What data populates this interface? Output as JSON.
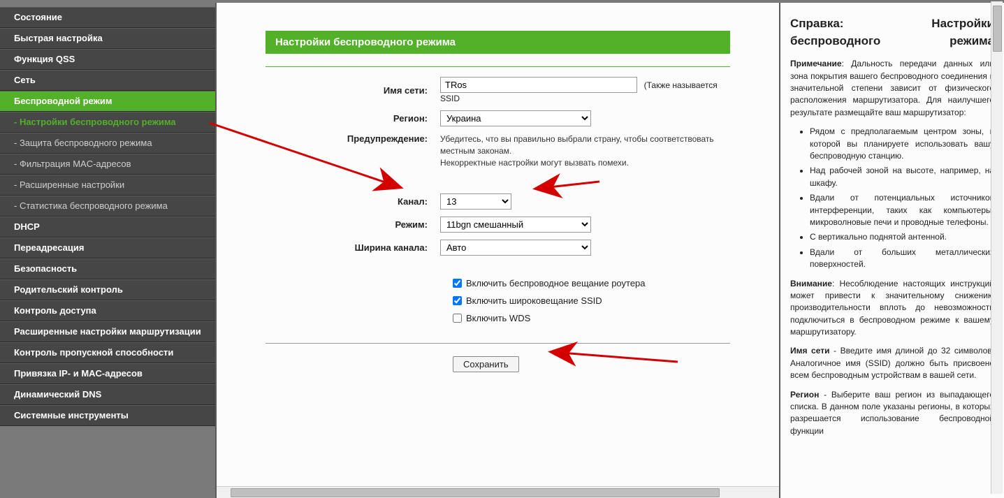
{
  "sidebar": {
    "items": [
      {
        "label": "Состояние",
        "type": "item"
      },
      {
        "label": "Быстрая настройка",
        "type": "item"
      },
      {
        "label": "Функция QSS",
        "type": "item"
      },
      {
        "label": "Сеть",
        "type": "item"
      },
      {
        "label": "Беспроводной режим",
        "type": "item",
        "active": true
      },
      {
        "label": "- Настройки беспроводного режима",
        "type": "sub",
        "current": true
      },
      {
        "label": "- Защита беспроводного режима",
        "type": "sub"
      },
      {
        "label": "- Фильтрация MAC-адресов",
        "type": "sub"
      },
      {
        "label": "- Расширенные настройки",
        "type": "sub"
      },
      {
        "label": "- Статистика беспроводного режима",
        "type": "sub"
      },
      {
        "label": "DHCP",
        "type": "item"
      },
      {
        "label": "Переадресация",
        "type": "item"
      },
      {
        "label": "Безопасность",
        "type": "item"
      },
      {
        "label": "Родительский контроль",
        "type": "item"
      },
      {
        "label": "Контроль доступа",
        "type": "item"
      },
      {
        "label": "Расширенные настройки маршрутизации",
        "type": "item"
      },
      {
        "label": "Контроль пропускной способности",
        "type": "item"
      },
      {
        "label": "Привязка IP- и MAC-адресов",
        "type": "item"
      },
      {
        "label": "Динамический DNS",
        "type": "item"
      },
      {
        "label": "Системные инструменты",
        "type": "item"
      }
    ]
  },
  "main": {
    "title": "Настройки беспроводного режима",
    "labels": {
      "ssid": "Имя сети:",
      "region": "Регион:",
      "warning": "Предупреждение:",
      "channel": "Канал:",
      "mode": "Режим:",
      "width": "Ширина канала:"
    },
    "ssid_value": "TRos",
    "ssid_note": "(Также называется SSID",
    "region_value": "Украина",
    "warning_text1": "Убедитесь, что вы правильно выбрали страну, чтобы соответствовать местным законам.",
    "warning_text2": "Некорректные настройки могут вызвать помехи.",
    "channel_value": "13",
    "mode_value": "11bgn смешанный",
    "width_value": "Авто",
    "cb_broadcast": "Включить беспроводное вещание роутера",
    "cb_ssid": "Включить широковещание SSID",
    "cb_wds": "Включить WDS",
    "save": "Сохранить"
  },
  "help": {
    "title": "Справка: Настройки беспроводного режима",
    "note_label": "Примечание",
    "note_text": ": Дальность передачи данных или зона покрытия вашего беспроводного соединения в значительной степени зависит от физического расположения маршрутизатора. Для наилучшего результате размещайте ваш маршрутизатор:",
    "bullets": [
      "Рядом с предполагаемым центром зоны, в которой вы планируете использовать вашу беспроводную станцию.",
      "Над рабочей зоной на высоте, например, на шкафу.",
      "Вдали от потенциальных источников интерференции, таких как компьютеры, микроволновые печи и проводные телефоны.",
      "С вертикально поднятой антенной.",
      "Вдали от больших металлических поверхностей."
    ],
    "warn_label": "Внимание",
    "warn_text": ": Несоблюдение настоящих инструкций может привести к значительному снижению производительности вплоть до невозможности подключиться в беспроводном режиме к вашему маршрутизатору.",
    "ssid_label": "Имя сети",
    "ssid_text": " - Введите имя длиной до 32 символов. Аналогичное имя (SSID) должно быть присвоено всем беспроводным устройствам в вашей сети.",
    "region_label": "Регион",
    "region_text": " - Выберите ваш регион из выпадающего списка. В данном поле указаны регионы, в которых разрешается использование беспроводной функции"
  }
}
